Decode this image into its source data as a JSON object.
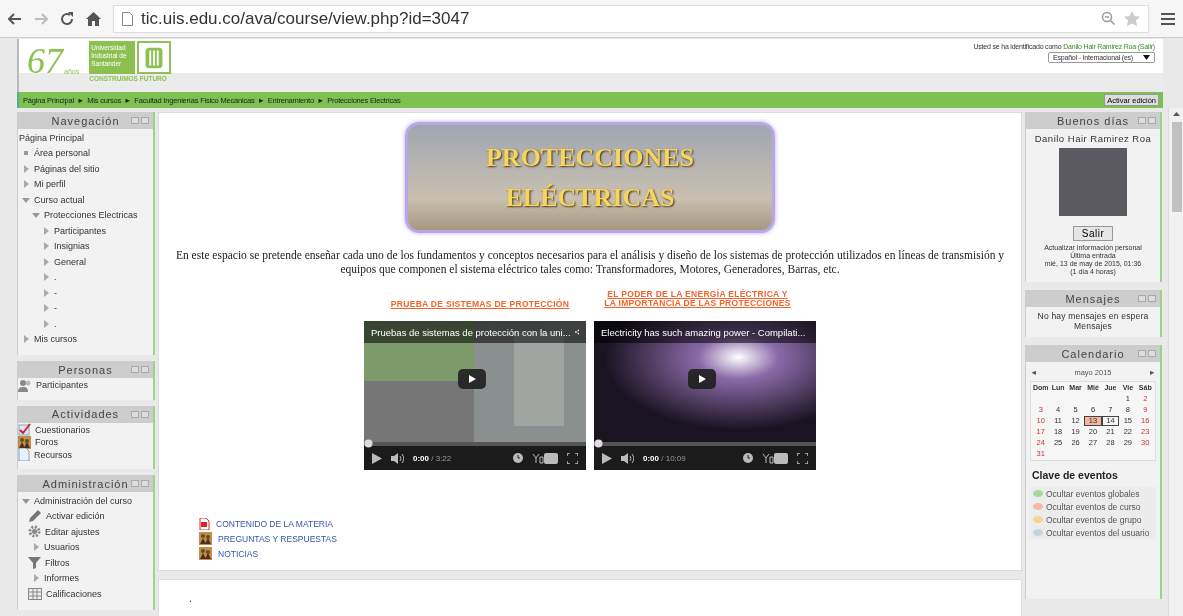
{
  "browser": {
    "url": "tic.uis.edu.co/ava/course/view.php?id=3047"
  },
  "header": {
    "years": "67",
    "years_sub": "años",
    "university": "Universidad Industrial de Santander",
    "slogan": "CONSTRUIMOS FUTURO",
    "login_prefix": "Usted se ha identificado como",
    "user_name": "Danilo Hair Ramirez Roa",
    "logout": "(Salir)",
    "language": "Español - Internacional (es)"
  },
  "breadcrumb": {
    "separator": "►",
    "items": [
      "Página Principal",
      "Mis cursos",
      "Facultad Ingenierías Fisico Mecánicas",
      "Entrenamiento",
      "Protecciones Electricas"
    ],
    "edit_button": "Activar edición"
  },
  "left_blocks": [
    {
      "title": "Navegación",
      "items": [
        {
          "label": "Página Principal",
          "kind": "plain"
        },
        {
          "label": "Área personal",
          "kind": "bullet"
        },
        {
          "label": "Páginas del sitio",
          "kind": "branch",
          "expanded": false
        },
        {
          "label": "Mi perfil",
          "kind": "branch",
          "expanded": false
        },
        {
          "label": "Curso actual",
          "kind": "branch",
          "expanded": true,
          "children": [
            {
              "label": "Protecciones Electricas",
              "kind": "branch",
              "expanded": true,
              "children": [
                {
                  "label": "Participantes",
                  "kind": "branch",
                  "expanded": false
                },
                {
                  "label": "Insignias",
                  "kind": "branch",
                  "expanded": false
                },
                {
                  "label": "General",
                  "kind": "branch",
                  "expanded": false
                },
                {
                  "label": ".",
                  "kind": "branch",
                  "expanded": false
                },
                {
                  "label": "-",
                  "kind": "branch",
                  "expanded": false
                },
                {
                  "label": "-",
                  "kind": "branch",
                  "expanded": false
                },
                {
                  "label": ".",
                  "kind": "branch",
                  "expanded": false
                }
              ]
            }
          ]
        },
        {
          "label": "Mis cursos",
          "kind": "branch",
          "expanded": false
        }
      ]
    },
    {
      "title": "Personas",
      "items": [
        {
          "label": "Participantes",
          "kind": "people"
        }
      ]
    },
    {
      "title": "Actividades",
      "items": [
        {
          "label": "Cuestionarios",
          "kind": "quiz"
        },
        {
          "label": "Foros",
          "kind": "forum"
        },
        {
          "label": "Recursos",
          "kind": "file"
        }
      ]
    },
    {
      "title": "Administración",
      "items": [
        {
          "label": "Administración del curso",
          "kind": "branch",
          "expanded": true,
          "children": [
            {
              "label": "Activar edición",
              "kind": "pencil"
            },
            {
              "label": "Editar ajustes",
              "kind": "gear"
            },
            {
              "label": "Usuarios",
              "kind": "branch",
              "expanded": false
            },
            {
              "label": "Filtros",
              "kind": "filter"
            },
            {
              "label": "Informes",
              "kind": "branch",
              "expanded": false
            },
            {
              "label": "Calificaciones",
              "kind": "table"
            }
          ]
        }
      ]
    }
  ],
  "main": {
    "banner": [
      "PROTECCIONES",
      "ELÉCTRICAS"
    ],
    "description": "En este espacio se pretende enseñar cada uno de los fundamentos y conceptos necesarios para el análisis y diseño de los sistemas de protección utilizados en líneas de transmisión y equipos que componen el sistema eléctrico tales como: Transformadores, Motores, Generadores, Barras, etc.",
    "links": [
      "PRUEBA DE SISTEMAS DE PROTECCIÓN",
      "EL PODER DE LA ENERGÍA ELÉCTRICA Y LA IMPORTANCIA DE LAS PROTECCIONES"
    ],
    "videos": [
      {
        "title": "Pruebas de sistemas de protección con la uni...",
        "time": "0:00",
        "duration": "/ 3:22",
        "kind": "indoor",
        "level": 0
      },
      {
        "title": "Electricity has such amazing power - Compilati...",
        "time": "0:00",
        "duration": "/ 10:09",
        "kind": "night",
        "level": 0
      }
    ],
    "resources": [
      {
        "label": "CONTENIDO DE LA MATERIA",
        "kind": "pdf"
      },
      {
        "label": "PREGUNTAS Y RESPUESTAS",
        "kind": "forum"
      },
      {
        "label": "NOTICIAS",
        "kind": "forum"
      }
    ],
    "section_text": "."
  },
  "user_block": {
    "title": "Buenos días",
    "name": "Danilo Hair Ramirez Roa",
    "button": "Salir",
    "update_link": "Actualizar información personal",
    "last_login_label": "Última entrada",
    "last_login": "mié, 13 de may de 2015, 01:36",
    "ago": "(1 día 4 horas)"
  },
  "messages_block": {
    "title": "Mensajes",
    "text": "No hay mensajes en espera",
    "link": "Mensajes"
  },
  "calendar_block": {
    "title": "Calendario",
    "prev": "◄",
    "month": "mayo 2015",
    "next": "►",
    "weekdays": [
      "Dom",
      "Lun",
      "Mar",
      "Mié",
      "Jue",
      "Vie",
      "Sáb"
    ],
    "weeks": [
      [
        {
          "kind": "blank"
        },
        {
          "kind": "blank"
        },
        {
          "kind": "blank"
        },
        {
          "kind": "blank"
        },
        {
          "kind": "blank"
        },
        {
          "kind": "day",
          "label": "1",
          "today": false,
          "event": false
        },
        {
          "kind": "day",
          "label": "2",
          "today": false,
          "event": false
        }
      ],
      [
        {
          "kind": "day",
          "label": "3",
          "today": false,
          "event": false
        },
        {
          "kind": "day",
          "label": "4",
          "today": false,
          "event": false
        },
        {
          "kind": "day",
          "label": "5",
          "today": false,
          "event": false
        },
        {
          "kind": "day",
          "label": "6",
          "today": false,
          "event": false
        },
        {
          "kind": "day",
          "label": "7",
          "today": false,
          "event": false
        },
        {
          "kind": "day",
          "label": "8",
          "today": false,
          "event": false
        },
        {
          "kind": "day",
          "label": "9",
          "today": false,
          "event": false
        }
      ],
      [
        {
          "kind": "day",
          "label": "10",
          "today": false,
          "event": false
        },
        {
          "kind": "day",
          "label": "11",
          "today": false,
          "event": false
        },
        {
          "kind": "day",
          "label": "12",
          "today": false,
          "event": false
        },
        {
          "kind": "day",
          "label": "13",
          "today": true,
          "event": false
        },
        {
          "kind": "day",
          "label": "14",
          "today": false,
          "event": true
        },
        {
          "kind": "day",
          "label": "15",
          "today": false,
          "event": false
        },
        {
          "kind": "day",
          "label": "16",
          "today": false,
          "event": false
        }
      ],
      [
        {
          "kind": "day",
          "label": "17",
          "today": false,
          "event": false
        },
        {
          "kind": "day",
          "label": "18",
          "today": false,
          "event": false
        },
        {
          "kind": "day",
          "label": "19",
          "today": false,
          "event": false
        },
        {
          "kind": "day",
          "label": "20",
          "today": false,
          "event": false
        },
        {
          "kind": "day",
          "label": "21",
          "today": false,
          "event": false
        },
        {
          "kind": "day",
          "label": "22",
          "today": false,
          "event": false
        },
        {
          "kind": "day",
          "label": "23",
          "today": false,
          "event": false
        }
      ],
      [
        {
          "kind": "day",
          "label": "24",
          "today": false,
          "event": false
        },
        {
          "kind": "day",
          "label": "25",
          "today": false,
          "event": false
        },
        {
          "kind": "day",
          "label": "26",
          "today": false,
          "event": false
        },
        {
          "kind": "day",
          "label": "27",
          "today": false,
          "event": false
        },
        {
          "kind": "day",
          "label": "28",
          "today": false,
          "event": false
        },
        {
          "kind": "day",
          "label": "29",
          "today": false,
          "event": false
        },
        {
          "kind": "day",
          "label": "30",
          "today": false,
          "event": false
        }
      ],
      [
        {
          "kind": "day",
          "label": "31",
          "today": false,
          "event": false
        },
        {
          "kind": "blank"
        },
        {
          "kind": "blank"
        },
        {
          "kind": "blank"
        },
        {
          "kind": "blank"
        },
        {
          "kind": "blank"
        },
        {
          "kind": "blank"
        }
      ]
    ],
    "key_title": "Clave de eventos",
    "key": [
      {
        "label": "Ocultar eventos globales",
        "color": "#a6d89a"
      },
      {
        "label": "Ocultar eventos de curso",
        "color": "#f4b9a6"
      },
      {
        "label": "Ocultar eventos de grupo",
        "color": "#f3d58c"
      },
      {
        "label": "Ocultar eventos del usuario",
        "color": "#c6d2da"
      }
    ]
  }
}
